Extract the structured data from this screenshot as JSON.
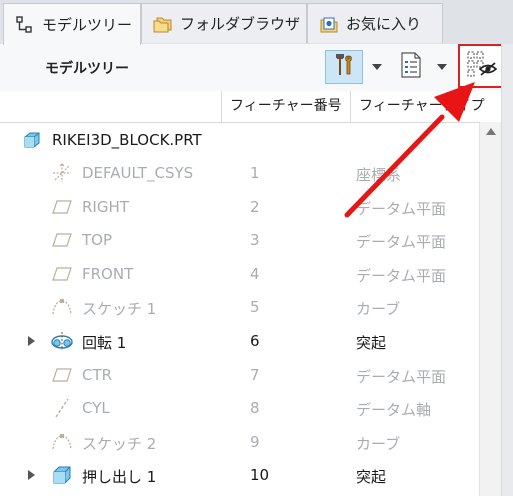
{
  "tabs": [
    {
      "label": "モデルツリー",
      "icon": "model-tree-icon",
      "active": true
    },
    {
      "label": "フォルダブラウザ",
      "icon": "folder-icon",
      "active": false
    },
    {
      "label": "お気に入り",
      "icon": "favorites-icon",
      "active": false
    }
  ],
  "panel": {
    "title": "モデルツリー"
  },
  "columns": {
    "name": "",
    "feature_number": "フィーチャー番号",
    "feature_type": "フィーチャータイプ"
  },
  "root": {
    "name": "RIKEI3D_BLOCK.PRT"
  },
  "rows": [
    {
      "name": "DEFAULT_CSYS",
      "num": "1",
      "type": "座標系",
      "icon": "csys-icon",
      "dim": true
    },
    {
      "name": "RIGHT",
      "num": "2",
      "type": "データム平面",
      "icon": "datum-plane-icon",
      "dim": true
    },
    {
      "name": "TOP",
      "num": "3",
      "type": "データム平面",
      "icon": "datum-plane-icon",
      "dim": true
    },
    {
      "name": "FRONT",
      "num": "4",
      "type": "データム平面",
      "icon": "datum-plane-icon",
      "dim": true
    },
    {
      "name": "スケッチ 1",
      "num": "5",
      "type": "カーブ",
      "icon": "sketch-icon",
      "dim": true
    },
    {
      "name": "回転 1",
      "num": "6",
      "type": "突起",
      "icon": "revolve-icon",
      "dim": false,
      "expandable": true
    },
    {
      "name": "CTR",
      "num": "7",
      "type": "データム平面",
      "icon": "datum-plane-icon",
      "dim": true
    },
    {
      "name": "CYL",
      "num": "8",
      "type": "データム軸",
      "icon": "datum-axis-icon",
      "dim": true
    },
    {
      "name": "スケッチ 2",
      "num": "9",
      "type": "カーブ",
      "icon": "sketch-icon",
      "dim": true
    },
    {
      "name": "押し出し 1",
      "num": "10",
      "type": "突起",
      "icon": "extrude-icon",
      "dim": false,
      "expandable": true
    }
  ],
  "colors": {
    "highlight": "#e02020",
    "accent": "#cde6f7"
  }
}
